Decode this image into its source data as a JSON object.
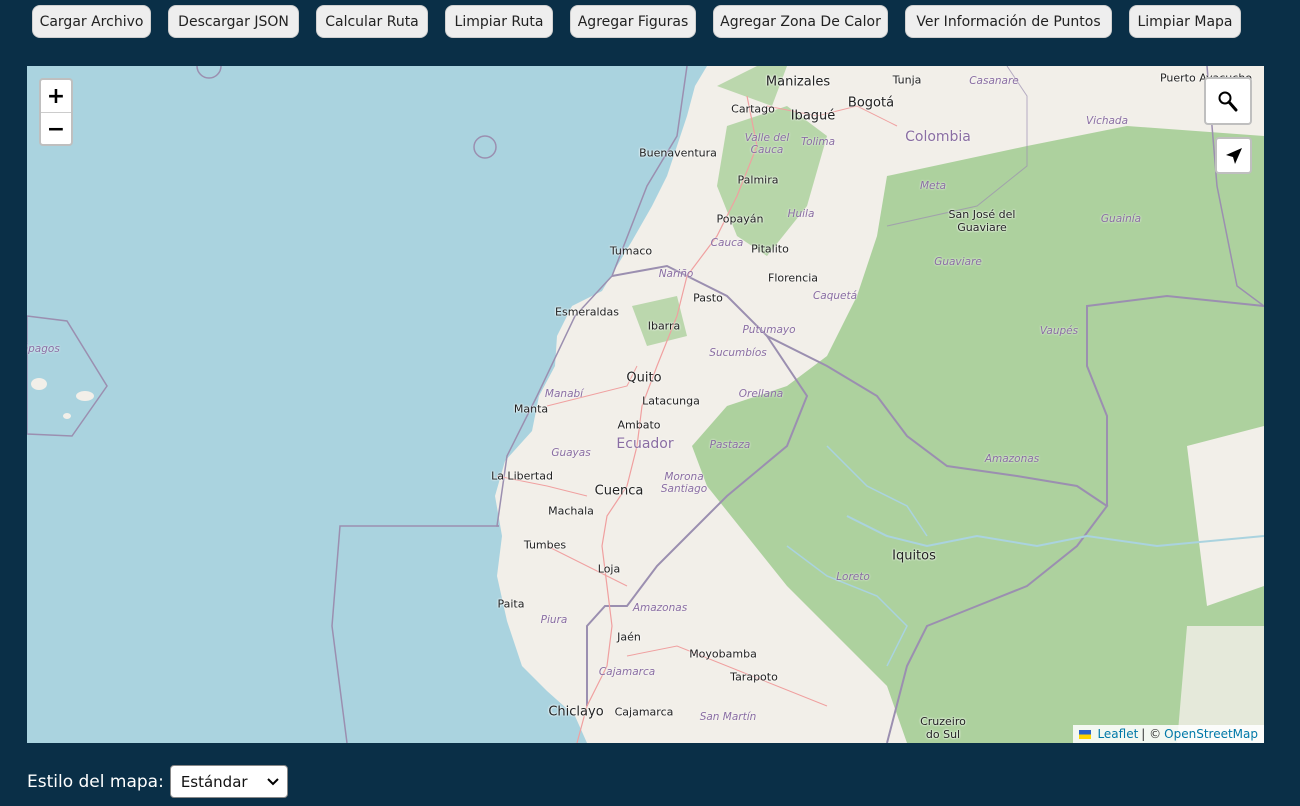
{
  "toolbar": {
    "buttons": [
      {
        "label": "Cargar Archivo"
      },
      {
        "label": "Descargar JSON"
      },
      {
        "label": "Calcular Ruta"
      },
      {
        "label": "Limpiar Ruta"
      },
      {
        "label": "Agregar Figuras"
      },
      {
        "label": "Agregar Zona De Calor"
      },
      {
        "label": "Ver Información de Puntos"
      },
      {
        "label": "Limpiar Mapa"
      }
    ]
  },
  "map": {
    "controls": {
      "zoom_in": "+",
      "zoom_out": "−",
      "search_icon": "search-icon",
      "locate_icon": "locate-arrow-icon"
    },
    "labels": {
      "countries": [
        "Colombia",
        "Ecuador"
      ],
      "cities": [
        "Puerto Ayacucho",
        "Manizales",
        "Bogotá",
        "Tunja",
        "Cartago",
        "Ibagué",
        "Buenaventura",
        "Palmira",
        "Popayán",
        "San José del Guaviare",
        "Tumaco",
        "Pitalito",
        "Florencia",
        "Pasto",
        "Esmeraldas",
        "Ibarra",
        "Quito",
        "Latacunga",
        "Manta",
        "Ambato",
        "La Libertad",
        "Cuenca",
        "Machala",
        "Tumbes",
        "Loja",
        "Iquitos",
        "Paita",
        "Jaén",
        "Moyobamba",
        "Tarapoto",
        "Chiclayo",
        "Cajamarca",
        "Cruzeiro do Sul"
      ],
      "regions": [
        "Casanare",
        "Vichada",
        "Valle del Cauca",
        "Tolima",
        "Meta",
        "Huila",
        "Guainía",
        "Cauca",
        "Guaviare",
        "Nariño",
        "Caquetá",
        "Putumayo",
        "Vaupés",
        "Sucumbíos",
        "Manabí",
        "Orellana",
        "Guayas",
        "Pastaza",
        "Morona Santiago",
        "Amazonas",
        "Loreto",
        "Piura",
        "Amazonas",
        "Cajamarca",
        "San Martín",
        "Galápagos"
      ]
    },
    "attribution": {
      "leaflet": "Leaflet",
      "separator": "| ©",
      "osm": "OpenStreetMap"
    },
    "colors": {
      "water": "#aad3df",
      "land": "#f2efe9",
      "forest": "#add19e",
      "border": "#9b8fb0"
    }
  },
  "style_selector": {
    "label": "Estilo del mapa:",
    "selected": "Estándar"
  }
}
